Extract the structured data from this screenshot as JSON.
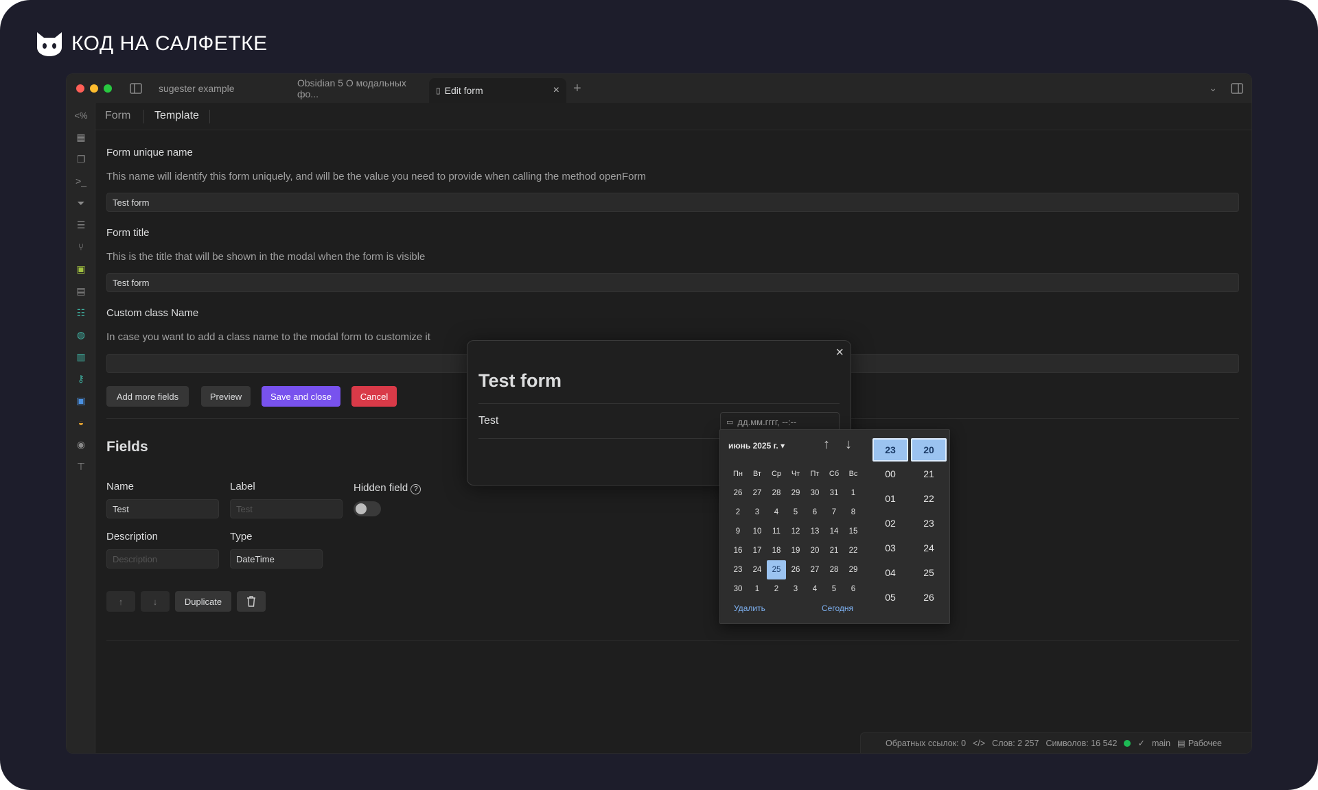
{
  "brand": {
    "name": "КОД НА САЛФЕТКЕ"
  },
  "window": {
    "tabs": [
      {
        "label": "sugester example"
      },
      {
        "label": "Obsidian 5 О модальных фо..."
      },
      {
        "label": "Edit form"
      }
    ],
    "new_tab": "+",
    "tab_close": "×"
  },
  "ribbon": {
    "top_label": "<%",
    "icons": [
      "calendar-icon",
      "files-icon",
      "terminal-icon",
      "filter-icon",
      "layers-icon",
      "git-branch-icon",
      "markdown-icon",
      "bookmark-icon",
      "tasks-icon",
      "globe-icon",
      "layout-icon",
      "key-icon",
      "save-icon",
      "cat-icon",
      "mic-icon",
      "podium-icon"
    ]
  },
  "subtabs": {
    "form": "Form",
    "template": "Template"
  },
  "form": {
    "unique_name": {
      "label": "Form unique name",
      "desc": "This name will identify this form uniquely, and will be the value you need to provide when calling the method openForm",
      "value": "Test form"
    },
    "title": {
      "label": "Form title",
      "desc": "This is the title that will be shown in the modal when the form is visible",
      "value": "Test form"
    },
    "class_name": {
      "label": "Custom class Name",
      "desc": "In case you want to add a class name to the modal form to customize it",
      "value": ""
    },
    "buttons": {
      "add": "Add more fields",
      "preview": "Preview",
      "save": "Save and close",
      "cancel": "Cancel"
    }
  },
  "fields": {
    "heading": "Fields",
    "name_label": "Name",
    "name_value": "Test",
    "label_label": "Label",
    "label_placeholder": "Test",
    "hidden_label": "Hidden field",
    "hidden_on": false,
    "desc_label": "Description",
    "desc_placeholder": "Description",
    "type_label": "Type",
    "type_value": "DateTime",
    "up": "↑",
    "down": "↓",
    "duplicate": "Duplicate"
  },
  "modal": {
    "title": "Test form",
    "field_label": "Test",
    "input_placeholder": "дд.мм.гггг, --:--",
    "close": "×"
  },
  "picker": {
    "month": "июнь 2025 г. ▾",
    "weekdays": [
      "Пн",
      "Вт",
      "Ср",
      "Чт",
      "Пт",
      "Сб",
      "Вс"
    ],
    "days": [
      "26",
      "27",
      "28",
      "29",
      "30",
      "31",
      "1",
      "2",
      "3",
      "4",
      "5",
      "6",
      "7",
      "8",
      "9",
      "10",
      "11",
      "12",
      "13",
      "14",
      "15",
      "16",
      "17",
      "18",
      "19",
      "20",
      "21",
      "22",
      "23",
      "24",
      "25",
      "26",
      "27",
      "28",
      "29",
      "30",
      "1",
      "2",
      "3",
      "4",
      "5",
      "6"
    ],
    "selected_day_index": 30,
    "clear": "Удалить",
    "today": "Сегодня",
    "hours": [
      "23",
      "00",
      "01",
      "02",
      "03",
      "04",
      "05"
    ],
    "minutes": [
      "20",
      "21",
      "22",
      "23",
      "24",
      "25",
      "26"
    ]
  },
  "status": {
    "backlinks": "Обратных ссылок: 0",
    "words": "Слов: 2 257",
    "chars": "Символов: 16 542",
    "branch": "main",
    "workspace": "Рабочее"
  }
}
